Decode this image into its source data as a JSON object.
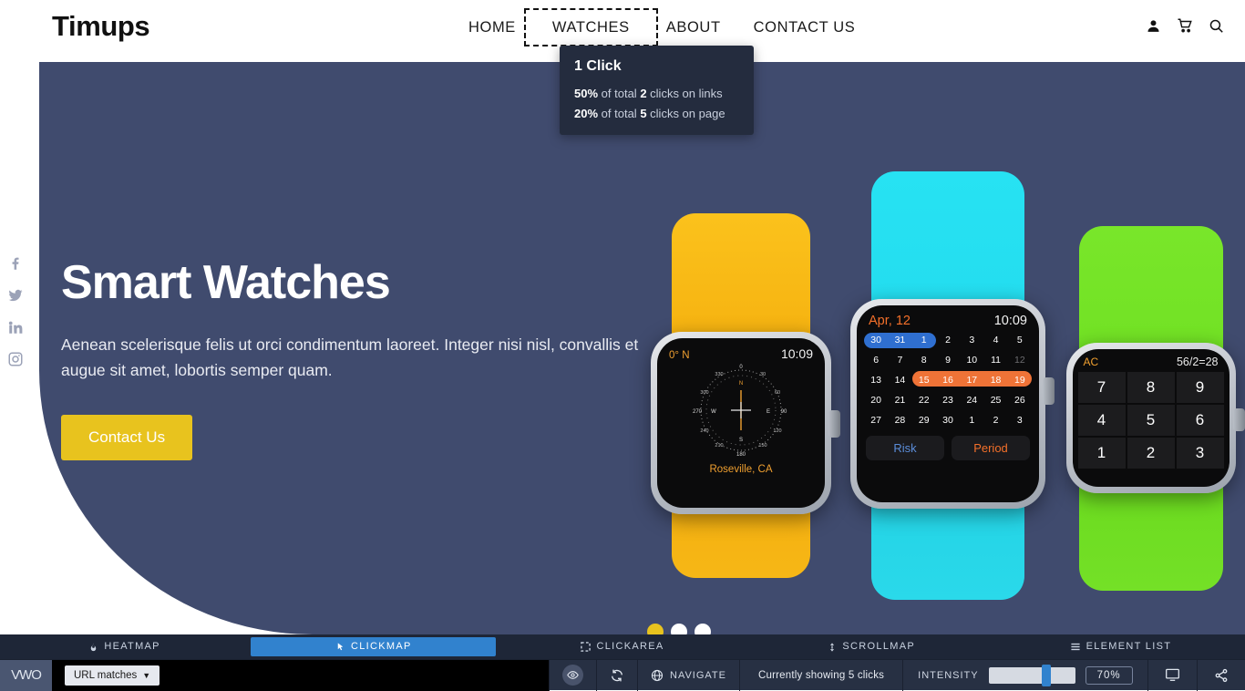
{
  "site": {
    "logo": "Timups",
    "nav": [
      {
        "label": "HOME",
        "selected": false
      },
      {
        "label": "WATCHES",
        "selected": true
      },
      {
        "label": "ABOUT",
        "selected": false
      },
      {
        "label": "CONTACT US",
        "selected": false
      }
    ],
    "header_icons": [
      "user-icon",
      "cart-icon",
      "search-icon"
    ],
    "social": [
      "facebook-icon",
      "twitter-icon",
      "linkedin-icon",
      "instagram-icon"
    ],
    "hero": {
      "title": "Smart Watches",
      "subtitle": "Aenean scelerisque felis ut orci condimentum laoreet. Integer nisi nisl, convallis et augue sit amet, lobortis semper quam.",
      "cta": "Contact Us",
      "bg_color": "#404b6e",
      "cta_color": "#e8c31e"
    },
    "carousel": {
      "count": 3,
      "active_index": 0,
      "active_color": "#e8c31e"
    }
  },
  "tooltip": {
    "title": "1 Click",
    "line1": {
      "percent": "50%",
      "mid": "of total",
      "count": "2",
      "tail": "clicks on links"
    },
    "line2": {
      "percent": "20%",
      "mid": "of total",
      "count": "5",
      "tail": "clicks on page"
    }
  },
  "watches": [
    {
      "name": "compass-watch",
      "band_color": "#fbc21c",
      "screen": {
        "app": "compass",
        "degrees": "0° N",
        "time": "10:09",
        "location": "Roseville, CA",
        "ticks": [
          "0",
          "30",
          "60",
          "90",
          "120",
          "150",
          "180",
          "210",
          "240",
          "270",
          "300",
          "330"
        ],
        "cardinals": [
          "N",
          "E",
          "S",
          "W"
        ]
      }
    },
    {
      "name": "calendar-watch",
      "band_color": "#27e2f3",
      "screen": {
        "app": "calendar",
        "month": "Apr, 12",
        "time": "10:09",
        "weeks": [
          [
            "30",
            "31",
            "1",
            "2",
            "3",
            "4",
            "5"
          ],
          [
            "6",
            "7",
            "8",
            "9",
            "10",
            "11",
            "12"
          ],
          [
            "13",
            "14",
            "15",
            "16",
            "17",
            "18",
            "19"
          ],
          [
            "20",
            "21",
            "22",
            "23",
            "24",
            "25",
            "26"
          ],
          [
            "27",
            "28",
            "29",
            "30",
            "1",
            "2",
            "3"
          ]
        ],
        "dim_cells": [
          "1-6"
        ],
        "highlight_blue": {
          "row": 0,
          "start": 0,
          "end": 2,
          "color": "#2f6fd0"
        },
        "highlight_orange": {
          "row": 2,
          "start": 2,
          "end": 6,
          "color": "#ef7337"
        },
        "buttons": [
          {
            "label": "Risk",
            "color": "#5b8dd9"
          },
          {
            "label": "Period",
            "color": "#f4702a"
          }
        ]
      }
    },
    {
      "name": "calculator-watch",
      "band_color": "#79e62a",
      "screen": {
        "app": "calculator",
        "clear": "AC",
        "expression": "56/2=28",
        "keys": [
          [
            "7",
            "8",
            "9"
          ],
          [
            "4",
            "5",
            "6"
          ],
          [
            "1",
            "2",
            "3"
          ]
        ]
      }
    }
  ],
  "vwo": {
    "tabs": [
      {
        "label": "HEATMAP",
        "icon": "flame-icon",
        "active": false
      },
      {
        "label": "CLICKMAP",
        "icon": "cursor-click-icon",
        "active": true
      },
      {
        "label": "CLICKAREA",
        "icon": "dashed-square-icon",
        "active": false
      },
      {
        "label": "SCROLLMAP",
        "icon": "up-down-arrow-icon",
        "active": false
      },
      {
        "label": "ELEMENT LIST",
        "icon": "list-icon",
        "active": false
      }
    ],
    "logo": "VWO",
    "url_matches": "URL matches",
    "navigate": "NAVIGATE",
    "showing": "Currently showing  5 clicks",
    "intensity_label": "INTENSITY",
    "intensity_value": "70%",
    "active_color": "#3182ce",
    "icons": [
      "eye-icon",
      "refresh-icon",
      "globe-icon",
      "monitor-icon",
      "share-icon"
    ]
  }
}
